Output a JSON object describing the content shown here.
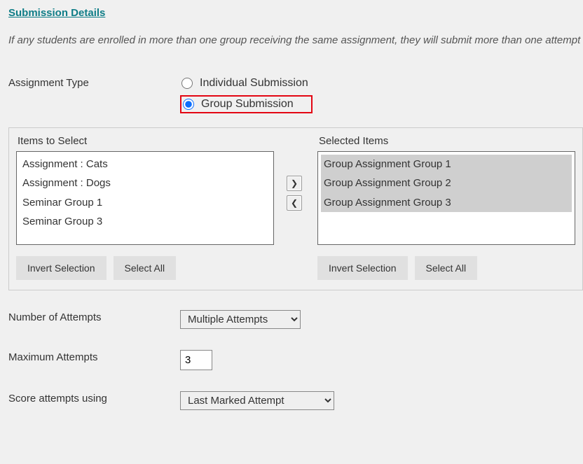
{
  "section_title": "Submission Details",
  "info_text": "If any students are enrolled in more than one group receiving the same assignment, they will submit more than one attempt for the assignment.",
  "assignment_type": {
    "label": "Assignment Type",
    "options": {
      "individual": "Individual Submission",
      "group": "Group Submission"
    },
    "selected": "group"
  },
  "dual": {
    "left": {
      "title": "Items to Select",
      "items": [
        "Assignment : Cats",
        "Assignment : Dogs",
        "Seminar Group 1",
        "Seminar Group 3"
      ],
      "invert": "Invert Selection",
      "select_all": "Select All"
    },
    "right": {
      "title": "Selected Items",
      "items": [
        "Group Assignment Group 1",
        "Group Assignment Group 2",
        "Group Assignment Group 3"
      ],
      "invert": "Invert Selection",
      "select_all": "Select All"
    }
  },
  "attempts": {
    "label": "Number of Attempts",
    "value": "Multiple Attempts"
  },
  "max_attempts": {
    "label": "Maximum Attempts",
    "value": "3"
  },
  "score": {
    "label": "Score attempts using",
    "value": "Last Marked Attempt"
  }
}
